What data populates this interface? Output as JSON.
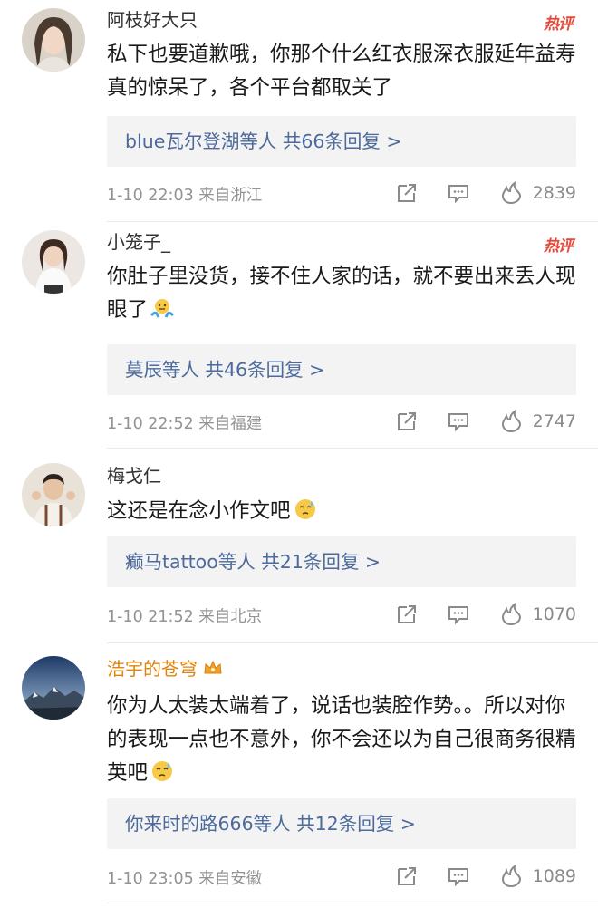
{
  "comments": [
    {
      "username": "阿枝好大只",
      "hot_tag": "热评",
      "text": "私下也要道歉哦，你那个什么红衣服深衣服延年益寿真的惊呆了，各个平台都取关了",
      "reply_summary": "blue瓦尔登湖等人 共66条回复 >",
      "time": "1-10 22:03 来自浙江",
      "likes": "2839"
    },
    {
      "username": "小笼子_",
      "hot_tag": "热评",
      "text": "你肚子里没货，接不住人家的话，就不要出来丢人现眼了",
      "reply_summary": "莫辰等人 共46条回复 >",
      "time": "1-10 22:52 来自福建",
      "likes": "2747"
    },
    {
      "username": "梅戈仁",
      "text": "这还是在念小作文吧",
      "reply_summary": "癫马tattoo等人 共21条回复 >",
      "time": "1-10 21:52 来自北京",
      "likes": "1070"
    },
    {
      "username": "浩宇的苍穹",
      "text": "你为人太装太端着了，说话也装腔作势。。所以对你的表现一点也不意外，你不会还以为自己很商务很精英吧",
      "reply_summary": "你来时的路666等人 共12条回复 >",
      "time": "1-10 23:05 来自安徽",
      "likes": "1089"
    }
  ],
  "colors": {
    "hot_tag": "#e24a3b",
    "reply_link": "#4c6a9b",
    "vip_name": "#e0840e",
    "meta": "#939393"
  },
  "icons": [
    "share-icon",
    "comment-icon",
    "like-icon",
    "shrug-emoji",
    "sweat-emoji",
    "vip-crown-icon"
  ]
}
